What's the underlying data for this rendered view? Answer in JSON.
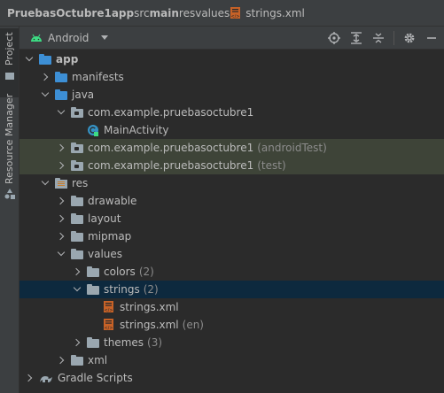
{
  "breadcrumb": [
    {
      "label": "PruebasOctubre1",
      "bold": true
    },
    {
      "label": "app",
      "bold": true
    },
    {
      "label": "src",
      "bold": false
    },
    {
      "label": "main",
      "bold": true
    },
    {
      "label": "res",
      "bold": false
    },
    {
      "label": "values",
      "bold": false
    },
    {
      "label": "strings.xml",
      "bold": false,
      "icon": "xml-file-icon"
    }
  ],
  "side": {
    "project": "Project",
    "resource_manager": "Resource Manager"
  },
  "toolbar": {
    "view": "Android",
    "icons": [
      "locate-icon",
      "expand-all-icon",
      "collapse-all-icon",
      "gear-icon",
      "minimize-icon"
    ]
  },
  "tree": [
    {
      "label": "app",
      "bold": true,
      "depth": 0,
      "arrow": "down",
      "icon": "module-folder-icon"
    },
    {
      "label": "manifests",
      "depth": 1,
      "arrow": "right",
      "icon": "folder-icon"
    },
    {
      "label": "java",
      "depth": 1,
      "arrow": "down",
      "icon": "folder-icon"
    },
    {
      "label": "com.example.pruebasoctubre1",
      "depth": 2,
      "arrow": "down",
      "icon": "package-icon"
    },
    {
      "label": "MainActivity",
      "depth": 3,
      "arrow": "none",
      "icon": "activity-class-icon"
    },
    {
      "label": "com.example.pruebasoctubre1",
      "suffix": "(androidTest)",
      "depth": 2,
      "arrow": "right",
      "icon": "package-icon",
      "highlight": true
    },
    {
      "label": "com.example.pruebasoctubre1",
      "suffix": "(test)",
      "depth": 2,
      "arrow": "right",
      "icon": "package-icon",
      "highlight": true
    },
    {
      "label": "res",
      "depth": 1,
      "arrow": "down",
      "icon": "res-folder-icon"
    },
    {
      "label": "drawable",
      "depth": 2,
      "arrow": "right",
      "icon": "folder-icon"
    },
    {
      "label": "layout",
      "depth": 2,
      "arrow": "right",
      "icon": "folder-icon"
    },
    {
      "label": "mipmap",
      "depth": 2,
      "arrow": "right",
      "icon": "folder-icon"
    },
    {
      "label": "values",
      "depth": 2,
      "arrow": "down",
      "icon": "folder-icon"
    },
    {
      "label": "colors",
      "suffix": "(2)",
      "depth": 3,
      "arrow": "right",
      "icon": "folder-icon"
    },
    {
      "label": "strings",
      "suffix": "(2)",
      "depth": 3,
      "arrow": "down",
      "icon": "folder-icon",
      "selected": true
    },
    {
      "label": "strings.xml",
      "depth": 4,
      "arrow": "none",
      "icon": "xml-file-icon"
    },
    {
      "label": "strings.xml",
      "suffix": "(en)",
      "depth": 4,
      "arrow": "none",
      "icon": "xml-file-icon"
    },
    {
      "label": "themes",
      "suffix": "(3)",
      "depth": 3,
      "arrow": "right",
      "icon": "folder-icon"
    },
    {
      "label": "xml",
      "depth": 2,
      "arrow": "right",
      "icon": "folder-icon"
    },
    {
      "label": "Gradle Scripts",
      "depth": 0,
      "arrow": "right",
      "icon": "gradle-icon"
    }
  ]
}
